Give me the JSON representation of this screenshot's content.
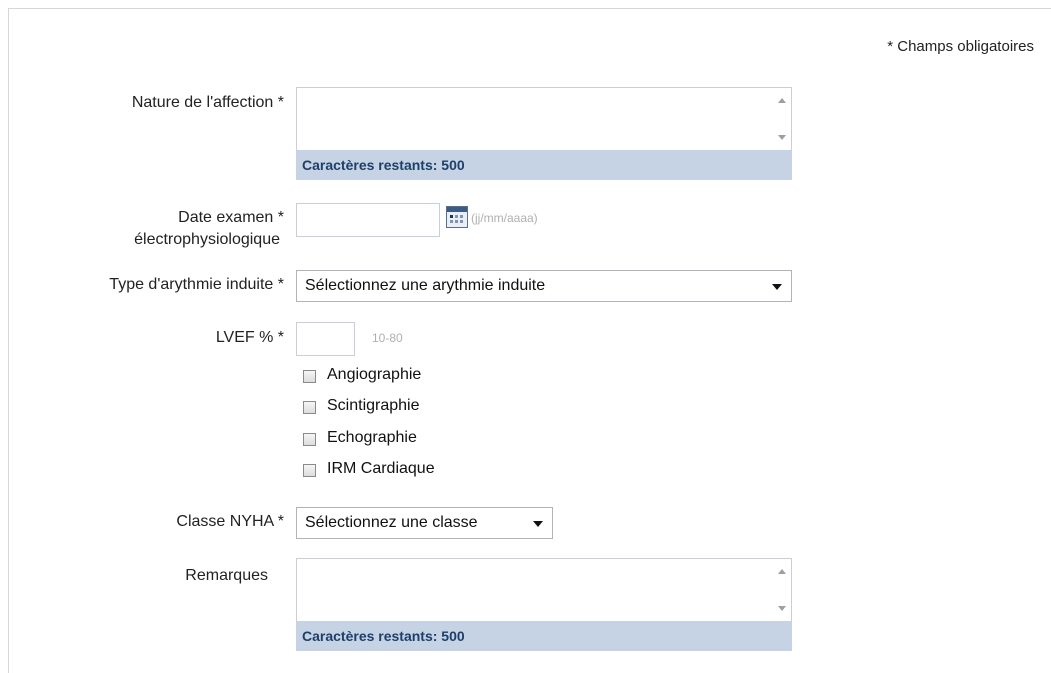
{
  "required_note": "* Champs obligatoires",
  "fields": {
    "nature": {
      "label": "Nature de l'affection *",
      "value": "",
      "counter": "Caractères restants: 500"
    },
    "date_exam": {
      "label_line1": "Date examen *",
      "label_line2": "électrophysiologique",
      "value": "",
      "hint": "(jj/mm/aaaa)",
      "icon": "calendar-icon"
    },
    "arythmie": {
      "label": "Type d'arythmie induite *",
      "selected": "Sélectionnez une arythmie induite"
    },
    "lvef": {
      "label": "LVEF % *",
      "value": "",
      "hint": "10-80"
    },
    "checkboxes": [
      {
        "label": "Angiographie",
        "checked": false
      },
      {
        "label": "Scintigraphie",
        "checked": false
      },
      {
        "label": "Echographie",
        "checked": false
      },
      {
        "label": "IRM Cardiaque",
        "checked": false
      }
    ],
    "nyha": {
      "label": "Classe NYHA *",
      "selected": "Sélectionnez une classe"
    },
    "remarques": {
      "label": "Remarques",
      "value": "",
      "counter": "Caractères restants: 500"
    }
  }
}
